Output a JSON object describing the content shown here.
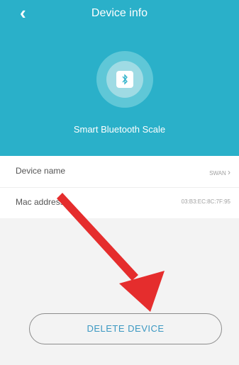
{
  "header": {
    "title": "Device info",
    "back_glyph": "‹",
    "device_label": "Smart Bluetooth Scale",
    "bluetooth_icon": "bluetooth-icon",
    "background_color": "#2ab0c9"
  },
  "device_info": {
    "rows": [
      {
        "label": "Device name",
        "value": "SWAN",
        "chevron": "›"
      },
      {
        "label": "Mac address",
        "value": "03:B3:EC:8C:7F:95"
      }
    ]
  },
  "delete_button": {
    "label": "DELETE DEVICE"
  },
  "annotation": {
    "arrow_color": "#e52d2d"
  }
}
